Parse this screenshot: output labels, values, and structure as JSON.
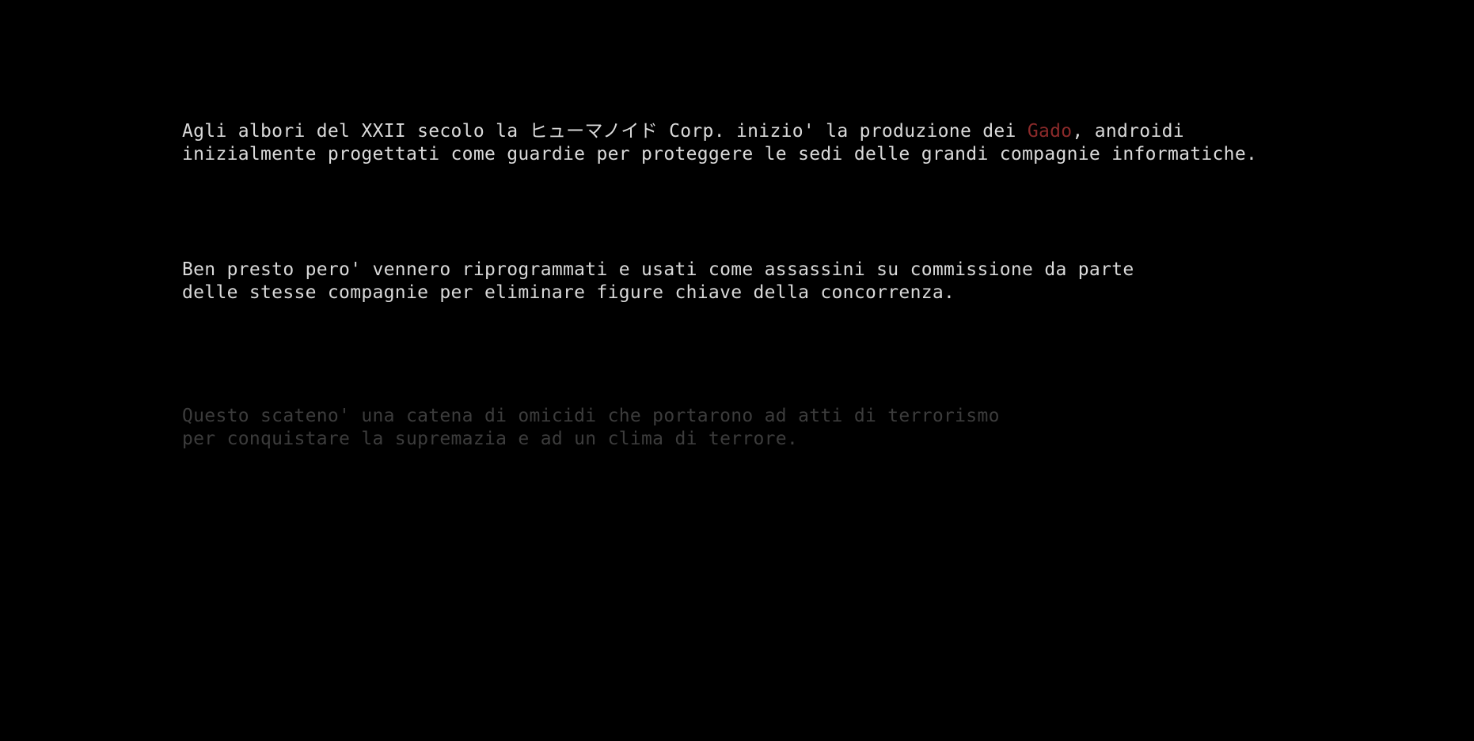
{
  "colors": {
    "background": "#000000",
    "text": "#d9d9d9",
    "highlight": "#8b2a2a",
    "faded": "#3c3c3c"
  },
  "paragraphs": [
    {
      "line1_pre": "Agli albori del XXII secolo la ヒューマノイド Corp. inizio' la produzione dei ",
      "highlight": "Gado",
      "line1_post": ", androidi",
      "line2": "inizialmente progettati come guardie per proteggere le sedi delle grandi compagnie informatiche."
    },
    {
      "line1": "Ben presto pero' vennero riprogrammati e usati come assassini su commissione da parte",
      "line2": "delle stesse compagnie per eliminare figure chiave della concorrenza."
    },
    {
      "line1": "Questo scateno' una catena di omicidi che portarono ad atti di terrorismo",
      "line2": "per conquistare la supremazia e ad un clima di terrore."
    }
  ]
}
